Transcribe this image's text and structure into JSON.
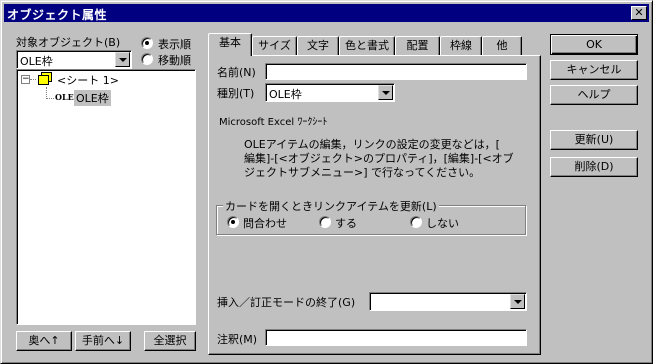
{
  "window": {
    "title": "オブジェクト属性",
    "close_label": "✕"
  },
  "left": {
    "target_label": "対象オブジェクト(B)",
    "sort_options": [
      "表示順",
      "移動順"
    ],
    "sort_selected": 0,
    "object_combo_value": "OLE枠",
    "tree": {
      "root_label": "<シート 1>",
      "child_label": "OLE枠",
      "child_icon_text": "OLE",
      "expand_symbol": "−"
    },
    "buttons": [
      "奥へ↑",
      "手前へ↓",
      "全選択"
    ]
  },
  "tabs": [
    "基本",
    "サイズ",
    "文字",
    "色と書式",
    "配置",
    "枠線",
    "他"
  ],
  "active_tab": 0,
  "basic": {
    "name_label": "名前(N)",
    "name_value": "",
    "type_label": "種別(T)",
    "type_value": "OLE枠",
    "class_name": "Microsoft Excel ﾜｰｸｼｰﾄ",
    "description_lines": [
      "OLEアイテムの編集，リンクの設定の変更などは，[",
      "編集]-[<オブジェクト>のプロパティ]，[編集]-[<オブ",
      "ジェクトサブメニュー>] で行なってください。"
    ],
    "update_group": {
      "title": "カードを開くときリンクアイテムを更新(L)",
      "options": [
        "問合わせ",
        "する",
        "しない"
      ],
      "selected": 0
    },
    "end_mode_label": "挿入／訂正モードの終了(G)",
    "end_mode_value": "",
    "note_label": "注釈(M)",
    "note_value": ""
  },
  "right_buttons": {
    "ok": "OK",
    "cancel": "キャンセル",
    "help": "ヘルプ",
    "update": "更新(U)",
    "delete": "削除(D)"
  }
}
